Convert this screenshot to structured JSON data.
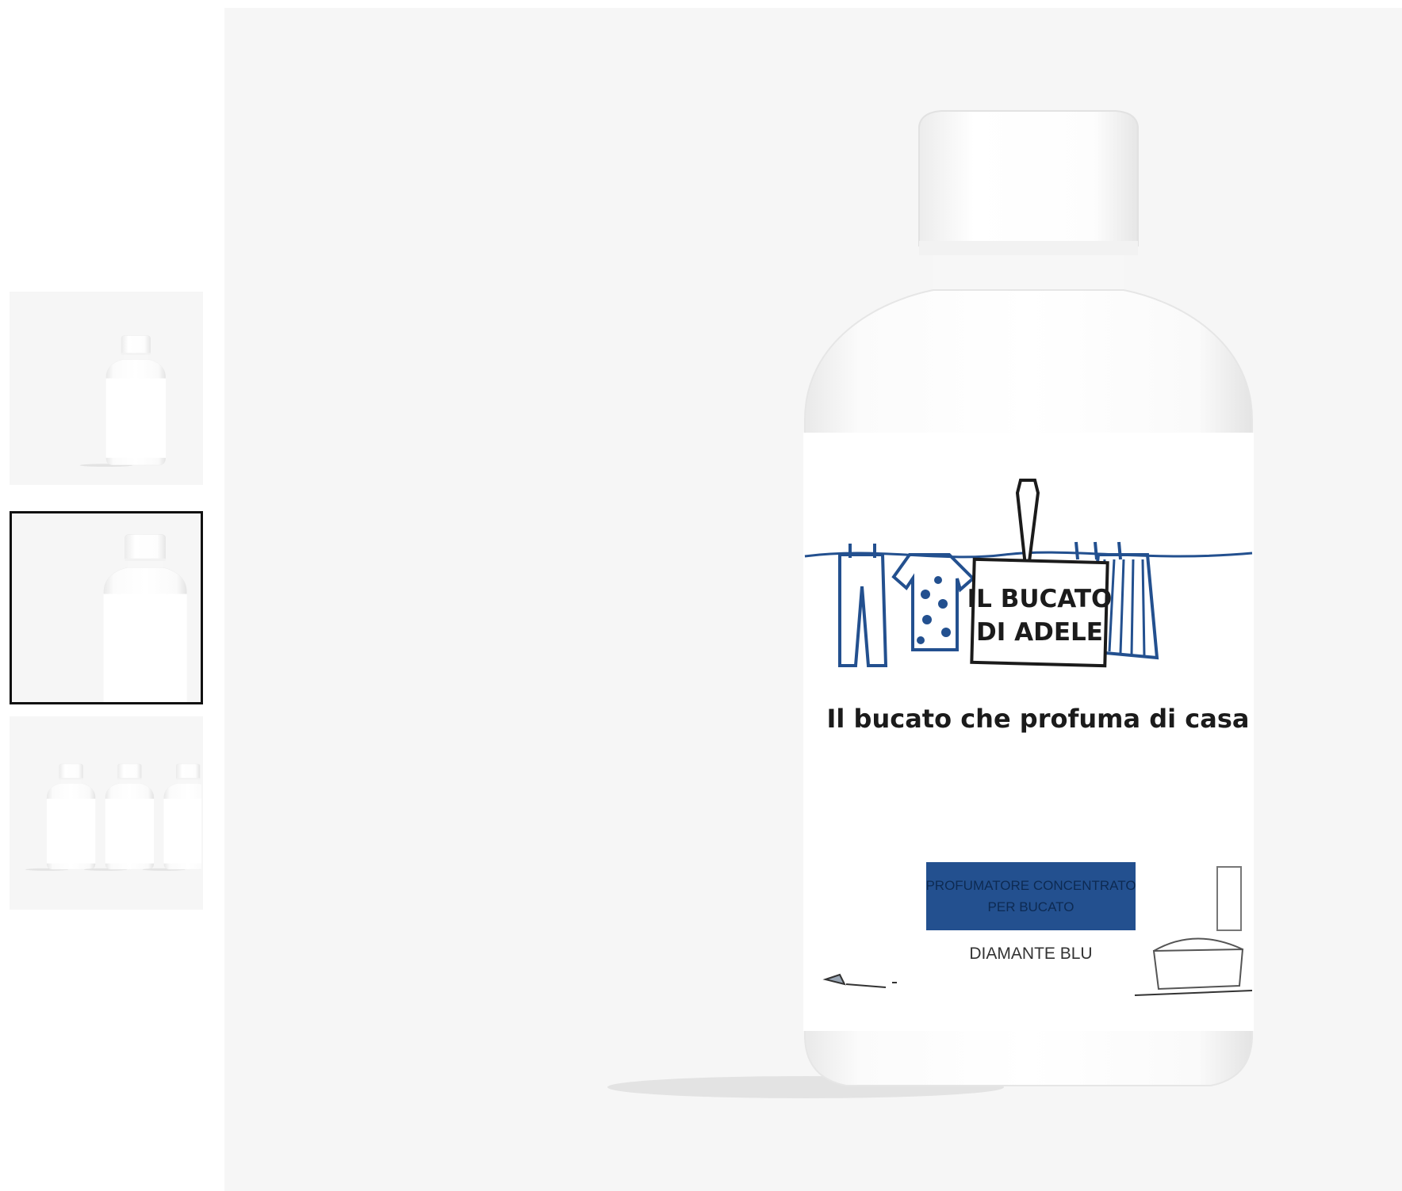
{
  "product": {
    "brand_line1": "IL BUCATO",
    "brand_line2": "DI ADELE",
    "tagline": "Il bucato che profuma di casa",
    "type_line1": "PROFUMATORE CONCENTRATO",
    "type_line2": "PER BUCATO",
    "variant": "DIAMANTE BLU"
  },
  "gallery": {
    "active_index": 1,
    "thumbnails": [
      {
        "kind": "single-bottle-small"
      },
      {
        "kind": "single-bottle-large"
      },
      {
        "kind": "three-bottles"
      }
    ]
  },
  "colors": {
    "accent_blue": "#23508f",
    "background": "#f6f6f6",
    "ink": "#1b1b1b"
  }
}
